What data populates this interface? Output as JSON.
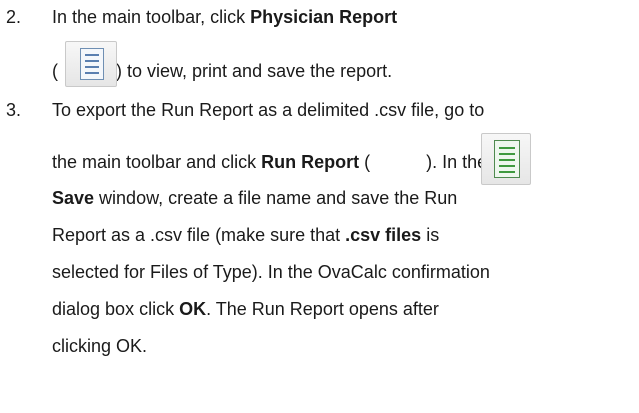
{
  "step2": {
    "number": "2.",
    "line1_pre": "In the main toolbar, click ",
    "line1_bold": "Physician Report",
    "line2_open": "(",
    "line2_post": ") to view, print and save the report.",
    "icon": "physician-report-icon"
  },
  "step3": {
    "number": "3.",
    "line1": "To export the Run Report as a delimited .csv file, go to",
    "line2_pre": "the main toolbar and click ",
    "line2_bold": "Run Report",
    "line2_open": " (",
    "line2_post": "). In the",
    "line3_bold": "Save",
    "line3_post": " window, create a file name and save the Run",
    "line4_pre": "Report as a .csv file (make sure that ",
    "line4_bold": ".csv files",
    "line4_post": " is",
    "line5": "selected for Files of Type). In the OvaCalc confirmation",
    "line6_pre": "dialog box click ",
    "line6_bold": "OK",
    "line6_post": ". The Run Report opens after",
    "line7": "clicking OK.",
    "icon": "run-report-icon"
  },
  "colors": {
    "physician_icon_accent": "#5a7fb0",
    "run_icon_accent": "#3f9a3f"
  }
}
